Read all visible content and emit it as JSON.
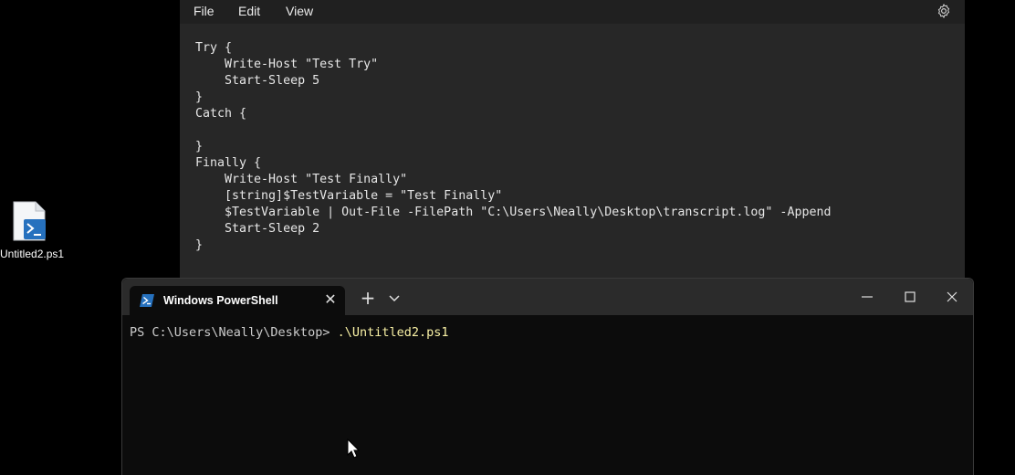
{
  "notepad": {
    "menu": {
      "file": "File",
      "edit": "Edit",
      "view": "View"
    },
    "settings_icon": "gear-icon",
    "code_lines": [
      "Try {",
      "    Write-Host \"Test Try\"",
      "    Start-Sleep 5",
      "}",
      "Catch {",
      "",
      "}",
      "Finally {",
      "    Write-Host \"Test Finally\"",
      "    [string]$TestVariable = \"Test Finally\"",
      "    $TestVariable | Out-File -FilePath \"C:\\Users\\Neally\\Desktop\\transcript.log\" -Append",
      "    Start-Sleep 2",
      "}"
    ]
  },
  "desktop": {
    "icon_label": "Untitled2.ps1",
    "icon_name": "powershell-script-file-icon"
  },
  "terminal": {
    "tab_title": "Windows PowerShell",
    "tab_icon": "powershell-icon",
    "new_tab_label": "+",
    "close_tab_label": "✕",
    "prompt": "PS C:\\Users\\Neally\\Desktop> ",
    "command": ".\\Untitled2.ps1"
  },
  "colors": {
    "notepad_bg": "#272727",
    "terminal_bg": "#0c0c0c",
    "command_color": "#f9f1a5",
    "powershell_blue": "#2671be"
  }
}
